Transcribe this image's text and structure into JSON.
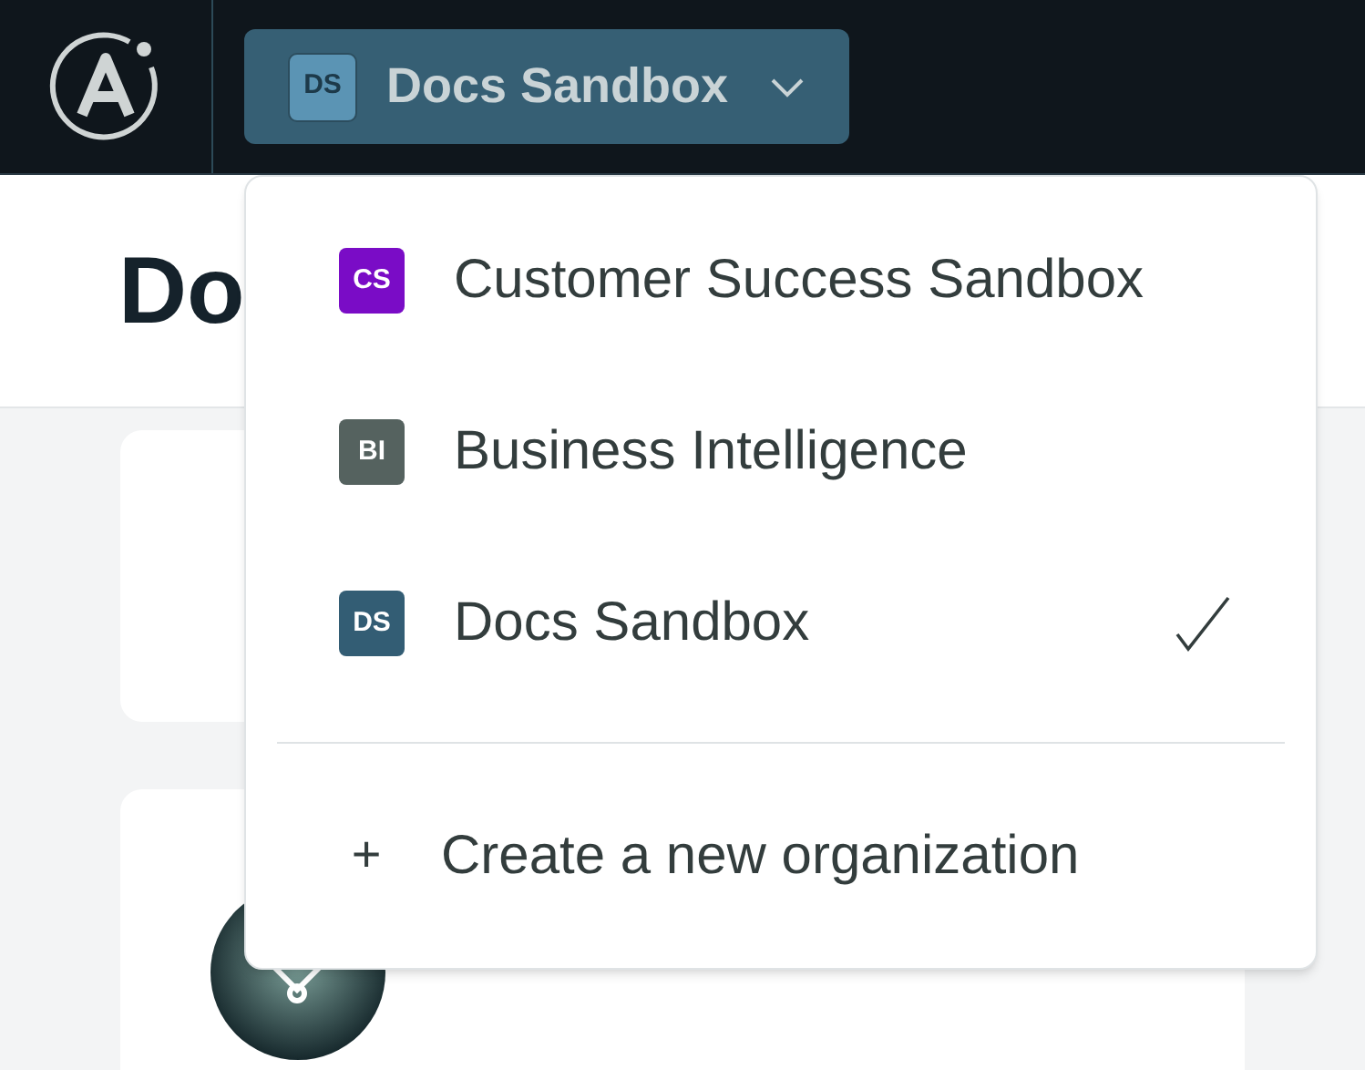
{
  "header": {
    "org_button": {
      "badge": "DS",
      "label": "Docs Sandbox"
    }
  },
  "page": {
    "heading": "Do"
  },
  "menu": {
    "orgs": [
      {
        "badge": "CS",
        "name": "Customer Success Sandbox",
        "color": "#7a0cc6",
        "selected": false
      },
      {
        "badge": "BI",
        "name": "Business Intelligence",
        "color": "#55625f",
        "selected": false
      },
      {
        "badge": "DS",
        "name": "Docs Sandbox",
        "color": "#335d74",
        "selected": true
      }
    ],
    "create": {
      "icon": "+",
      "label": "Create a new organization"
    }
  }
}
